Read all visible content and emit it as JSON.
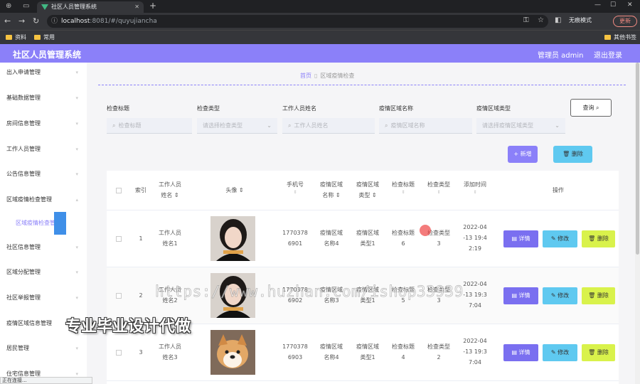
{
  "browser": {
    "tab_title": "社区人员管理系统",
    "url_host": "localhost",
    "url_path": ":8081/#/quyujiancha",
    "profile_label": "无痕模式",
    "update_label": "更新",
    "bookmarks": [
      "资料",
      "常用"
    ],
    "other_bookmarks": "其他书签"
  },
  "header": {
    "brand": "社区人员管理系统",
    "user": "管理员 admin",
    "logout": "退出登录"
  },
  "sidebar": {
    "items": [
      "出入申请管理",
      "基础数据管理",
      "房间信息管理",
      "工作人员管理",
      "公告信息管理",
      "区域疫情检查管理",
      "社区信息管理",
      "区域分配管理",
      "社区举报管理",
      "疫情区域信息管理",
      "居民管理",
      "住宅信息管理"
    ],
    "sub_item": "区域疫情检查管理"
  },
  "breadcrumb": {
    "home": "首页",
    "current": "区域疫情检查"
  },
  "filters": {
    "labels": [
      "检查标题",
      "检查类型",
      "工作人员姓名",
      "疫情区域名称",
      "疫情区域类型"
    ],
    "placeholders": [
      "检查标题",
      "请选择检查类型",
      "工作人员姓名",
      "疫情区域名称",
      "请选择疫情区域类型"
    ],
    "query": "查询"
  },
  "actions": {
    "add": "新增",
    "delete": "删除"
  },
  "table": {
    "headers": {
      "index": "索引",
      "worker_line1": "工作人员",
      "worker_line2": "姓名",
      "avatar": "头像",
      "phone": "手机号",
      "area_name_line1": "疫情区域",
      "area_name_line2": "名称",
      "area_type_line1": "疫情区域",
      "area_type_line2": "类型",
      "check_title": "检查标题",
      "check_type": "检查类型",
      "added_time": "添加时间",
      "ops": "操作"
    },
    "rows": [
      {
        "index": "1",
        "name1": "工作人员",
        "name2": "姓名1",
        "phone1": "1770378",
        "phone2": "6901",
        "an1": "疫情区域",
        "an2": "名称4",
        "at1": "疫情区域",
        "at2": "类型1",
        "ct1": "检查标题",
        "ct2": "6",
        "ck1": "检查类型",
        "ck2": "3",
        "t1": "2022-04",
        "t2": "-13 19:4",
        "t3": "2:19"
      },
      {
        "index": "2",
        "name1": "工作人员",
        "name2": "姓名2",
        "phone1": "1770378",
        "phone2": "6902",
        "an1": "疫情区域",
        "an2": "名称3",
        "at1": "疫情区域",
        "at2": "类型1",
        "ct1": "检查标题",
        "ct2": "5",
        "ck1": "检查类型",
        "ck2": "3",
        "t1": "2022-04",
        "t2": "-13 19:3",
        "t3": "7:04"
      },
      {
        "index": "3",
        "name1": "工作人员",
        "name2": "姓名3",
        "phone1": "1770378",
        "phone2": "6903",
        "an1": "疫情区域",
        "an2": "名称4",
        "at1": "疫情区域",
        "at2": "类型1",
        "ct1": "检查标题",
        "ct2": "4",
        "ck1": "检查类型",
        "ck2": "2",
        "t1": "2022-04",
        "t2": "-13 19:3",
        "t3": "7:04"
      }
    ],
    "detail": "详情",
    "edit": "修改",
    "delete": "删除"
  },
  "status_text": "正在连接...",
  "watermark": "https://www.huzhan.com/ishop33939",
  "promo": "专业毕业设计代做",
  "colors": {
    "primary": "#8b80f9",
    "info": "#5fc9f0",
    "lime": "#d9f24b",
    "nav_indicator": "#3f8fe8"
  }
}
